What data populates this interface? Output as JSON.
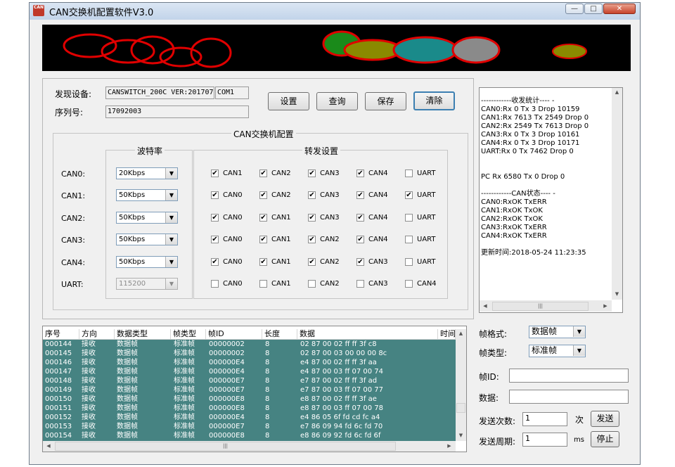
{
  "window": {
    "title": "CAN交换机配置软件V3.0",
    "app_icon_text": "CAN"
  },
  "device": {
    "found_label": "发现设备:",
    "device_value": "CANSWITCH_200C VER:201707",
    "port_value": "COM1",
    "serial_label": "序列号:",
    "serial_value": "17092003"
  },
  "buttons": {
    "settings": "设置",
    "query": "查询",
    "save": "保存",
    "clear": "清除",
    "send": "发送",
    "stop": "停止"
  },
  "config": {
    "group_title": "CAN交换机配置",
    "baud_title": "波特率",
    "forward_title": "转发设置",
    "rows": [
      {
        "label": "CAN0:",
        "baud": "20Kbps",
        "disabled": false,
        "targets": [
          {
            "name": "CAN1",
            "checked": true
          },
          {
            "name": "CAN2",
            "checked": true
          },
          {
            "name": "CAN3",
            "checked": true
          },
          {
            "name": "CAN4",
            "checked": true
          },
          {
            "name": "UART",
            "checked": false
          }
        ]
      },
      {
        "label": "CAN1:",
        "baud": "50Kbps",
        "disabled": false,
        "targets": [
          {
            "name": "CAN0",
            "checked": true
          },
          {
            "name": "CAN2",
            "checked": true
          },
          {
            "name": "CAN3",
            "checked": true
          },
          {
            "name": "CAN4",
            "checked": true
          },
          {
            "name": "UART",
            "checked": true
          }
        ]
      },
      {
        "label": "CAN2:",
        "baud": "50Kbps",
        "disabled": false,
        "targets": [
          {
            "name": "CAN0",
            "checked": true
          },
          {
            "name": "CAN1",
            "checked": true
          },
          {
            "name": "CAN3",
            "checked": true
          },
          {
            "name": "CAN4",
            "checked": true
          },
          {
            "name": "UART",
            "checked": false
          }
        ]
      },
      {
        "label": "CAN3:",
        "baud": "50Kbps",
        "disabled": false,
        "targets": [
          {
            "name": "CAN0",
            "checked": true
          },
          {
            "name": "CAN1",
            "checked": true
          },
          {
            "name": "CAN2",
            "checked": true
          },
          {
            "name": "CAN4",
            "checked": true
          },
          {
            "name": "UART",
            "checked": false
          }
        ]
      },
      {
        "label": "CAN4:",
        "baud": "50Kbps",
        "disabled": false,
        "targets": [
          {
            "name": "CAN0",
            "checked": true
          },
          {
            "name": "CAN1",
            "checked": true
          },
          {
            "name": "CAN2",
            "checked": true
          },
          {
            "name": "CAN3",
            "checked": true
          },
          {
            "name": "UART",
            "checked": false
          }
        ]
      },
      {
        "label": "UART:",
        "baud": "115200",
        "disabled": true,
        "targets": [
          {
            "name": "CAN0",
            "checked": false
          },
          {
            "name": "CAN1",
            "checked": false
          },
          {
            "name": "CAN2",
            "checked": false
          },
          {
            "name": "CAN3",
            "checked": false
          },
          {
            "name": "CAN4",
            "checked": false
          }
        ]
      }
    ]
  },
  "stats": {
    "lines": [
      "------------收发统计---- -",
      "CAN0:Rx 0 Tx 3 Drop 10159",
      "CAN1:Rx 7613 Tx 2549 Drop 0",
      "CAN2:Rx 2549 Tx 7613 Drop 0",
      "CAN3:Rx 0 Tx 3 Drop 10161",
      "CAN4:Rx 0 Tx 3 Drop 10171",
      "UART:Rx 0 Tx 7462 Drop 0",
      "",
      "",
      "PC Rx 6580 Tx 0 Drop 0",
      "",
      "------------CAN状态---- -",
      "CAN0:RxOK TxERR",
      "CAN1:RxOK TxOK",
      "CAN2:RxOK TxOK",
      "CAN3:RxOK TxERR",
      "CAN4:RxOK TxERR",
      "",
      "更新时间:2018-05-24 11:23:35"
    ]
  },
  "table": {
    "columns": [
      "序号",
      "方向",
      "数据类型",
      "帧类型",
      "帧ID",
      "长度",
      "数据",
      "时间"
    ],
    "rows": [
      [
        "000144",
        "接收",
        "数据帧",
        "标准帧",
        "00000002",
        "8",
        "02 87 00 02 ff ff 3f c8"
      ],
      [
        "000145",
        "接收",
        "数据帧",
        "标准帧",
        "00000002",
        "8",
        "02 87 00 03 00 00 00 8c"
      ],
      [
        "000146",
        "接收",
        "数据帧",
        "标准帧",
        "000000E4",
        "8",
        "e4 87 00 02 ff ff 3f aa"
      ],
      [
        "000147",
        "接收",
        "数据帧",
        "标准帧",
        "000000E4",
        "8",
        "e4 87 00 03 ff 07 00 74"
      ],
      [
        "000148",
        "接收",
        "数据帧",
        "标准帧",
        "000000E7",
        "8",
        "e7 87 00 02 ff ff 3f ad"
      ],
      [
        "000149",
        "接收",
        "数据帧",
        "标准帧",
        "000000E7",
        "8",
        "e7 87 00 03 ff 07 00 77"
      ],
      [
        "000150",
        "接收",
        "数据帧",
        "标准帧",
        "000000E8",
        "8",
        "e8 87 00 02 ff ff 3f ae"
      ],
      [
        "000151",
        "接收",
        "数据帧",
        "标准帧",
        "000000E8",
        "8",
        "e8 87 00 03 ff 07 00 78"
      ],
      [
        "000152",
        "接收",
        "数据帧",
        "标准帧",
        "000000E4",
        "8",
        "e4 86 05 6f fd cd fc a4"
      ],
      [
        "000153",
        "接收",
        "数据帧",
        "标准帧",
        "000000E7",
        "8",
        "e7 86 09 94 fd 6c fd 70"
      ],
      [
        "000154",
        "接收",
        "数据帧",
        "标准帧",
        "000000E8",
        "8",
        "e8 86 09 92 fd 6c fd 6f"
      ]
    ]
  },
  "send": {
    "frame_format_label": "帧格式:",
    "frame_format_value": "数据帧",
    "frame_type_label": "帧类型:",
    "frame_type_value": "标准帧",
    "frame_id_label": "帧ID:",
    "frame_id_value": "",
    "data_label": "数据:",
    "data_value": "",
    "count_label": "发送次数:",
    "count_value": "1",
    "count_unit": "次",
    "period_label": "发送周期:",
    "period_value": "1",
    "period_unit": "ms"
  },
  "colors": {
    "table_bg": "#468382",
    "banner_bg": "#000000",
    "circle_stroke": "#e00000",
    "bubble_green": "#1a8a1a",
    "bubble_olive": "#8a8a00",
    "bubble_teal": "#1a8a8a",
    "bubble_gray": "#8a8a8a"
  }
}
